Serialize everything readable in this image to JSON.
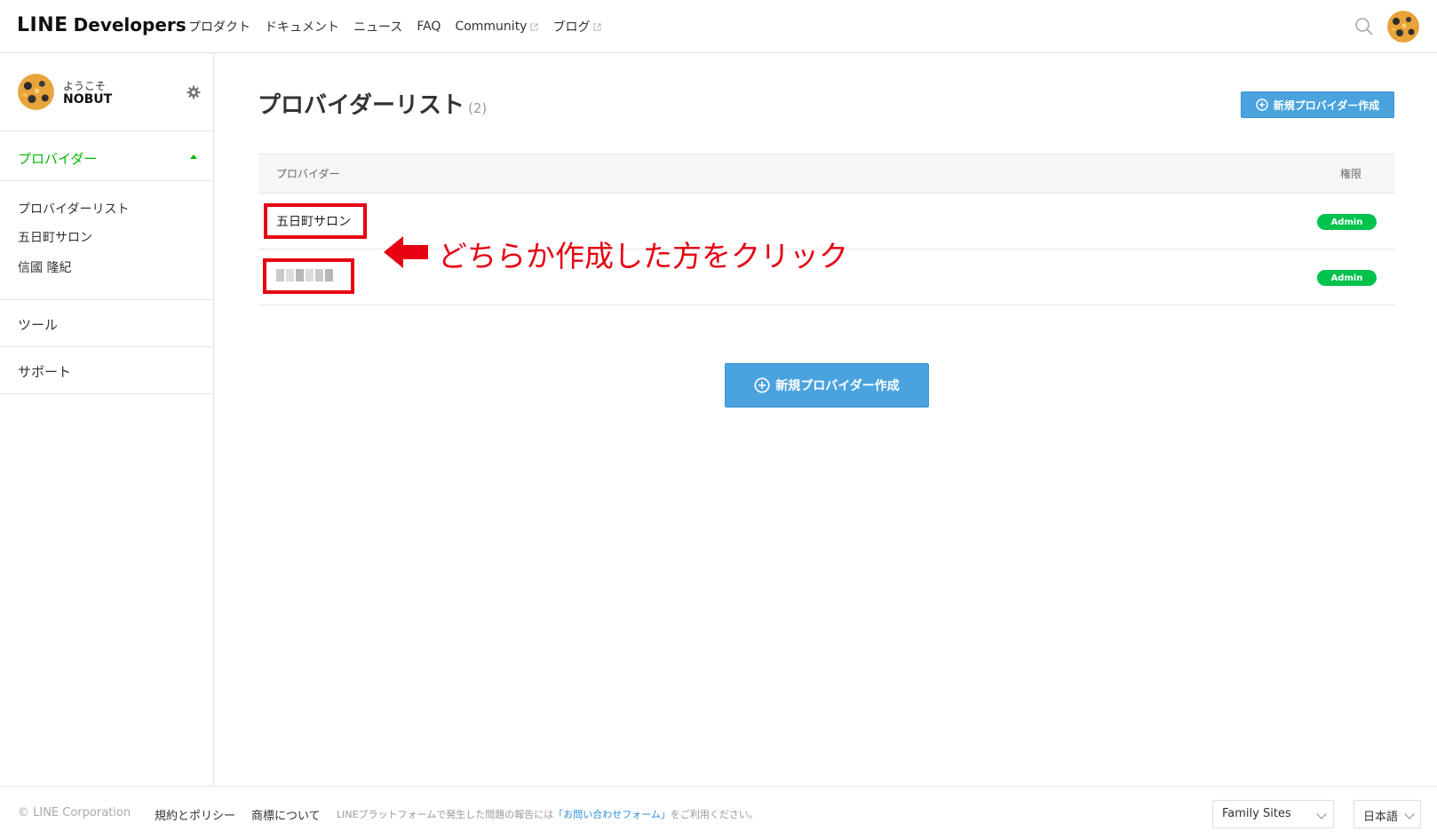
{
  "header": {
    "logo_line": "LINE",
    "logo_developers": "Developers",
    "nav": [
      {
        "label": "プロダクト",
        "external": false
      },
      {
        "label": "ドキュメント",
        "external": false
      },
      {
        "label": "ニュース",
        "external": false
      },
      {
        "label": "FAQ",
        "external": false
      },
      {
        "label": "Community",
        "external": true
      },
      {
        "label": "ブログ",
        "external": true
      }
    ]
  },
  "sidebar": {
    "welcome": "ようこそ",
    "username": "NOBUT",
    "section_provider": "プロバイダー",
    "sub_items": [
      "プロバイダーリスト",
      "五日町サロン",
      "信國 隆紀"
    ],
    "tools": "ツール",
    "support": "サポート"
  },
  "main": {
    "title": "プロバイダーリスト",
    "count": "(2)",
    "new_button": "新規プロバイダー作成",
    "table": {
      "col_provider": "プロバイダー",
      "col_role": "権限",
      "rows": [
        {
          "name": "五日町サロン",
          "role": "Admin"
        },
        {
          "name": "",
          "role": "Admin"
        }
      ]
    },
    "annotation": "どちらか作成した方をクリック",
    "new_button_center": "新規プロバイダー作成"
  },
  "footer": {
    "copyright": "© LINE Corporation",
    "terms": "規約とポリシー",
    "trademark": "商標について",
    "note_prefix": "LINEプラットフォームで発生した問題の報告には",
    "note_link": "「お問い合わせフォーム」",
    "note_suffix": "をご利用ください。",
    "family_sites": "Family Sites",
    "language": "日本語"
  },
  "colors": {
    "brand_green": "#00b900",
    "button_blue": "#4aa3df",
    "annotation_red": "#e60012",
    "badge_green": "#00c34d"
  }
}
